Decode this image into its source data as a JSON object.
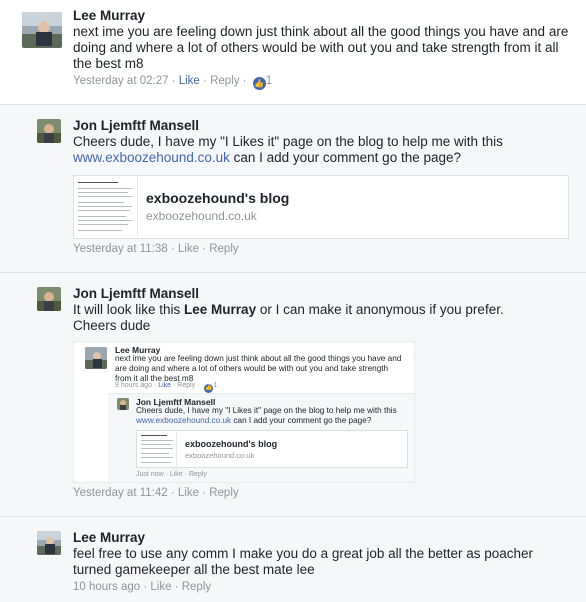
{
  "comments": [
    {
      "author": "Lee Murray",
      "text": "next ime you are feeling down just think about all the good things you have and are doing and where a lot of others would be with out you and take strength from it all the best m8",
      "time": "Yesterday at 02:27",
      "like_label": "Like",
      "reply_label": "Reply",
      "reaction_count": "1",
      "avatar_icon": "profile-photo-icon"
    },
    {
      "author": "Jon Ljemftf Mansell",
      "text_before_link": "Cheers dude, I have my \"I Likes it\" page on the blog to help me with this",
      "link": "www.exboozehound.co.uk",
      "text_after_link": " can I add your comment go the page?",
      "card_title": "exboozehound's blog",
      "card_domain": "exboozehound.co.uk",
      "time": "Yesterday at 11:38",
      "like_label": "Like",
      "reply_label": "Reply",
      "avatar_icon": "profile-photo-icon"
    },
    {
      "author": "Jon Ljemftf Mansell",
      "text_before_mention": "It will look like this ",
      "mention": "Lee Murray",
      "text_after_mention": " or I can make it anonymous if you prefer.",
      "text_line2": "Cheers dude",
      "time": "Yesterday at 11:42",
      "like_label": "Like",
      "reply_label": "Reply",
      "avatar_icon": "profile-photo-icon"
    },
    {
      "author": "Lee Murray",
      "text": "feel free to use any comm I make you do a great job all the better as poacher turned gamekeeper all the best mate lee",
      "time": "10 hours ago",
      "like_label": "Like",
      "reply_label": "Reply",
      "avatar_icon": "profile-photo-icon"
    }
  ],
  "embedded_screenshot": {
    "c1_author": "Lee Murray",
    "c1_text": "next ime you are feeling down just think about all the good things you have and are doing and where a lot of others would be with out you and take strength from it all the best m8",
    "c1_time": "9 hours ago",
    "c1_like": "Like",
    "c1_reply": "Reply",
    "c1_count": "1",
    "c2_author": "Jon Ljemftf Mansell",
    "c2_text_before_link": "Cheers dude, I have my \"I Likes it\" page on the blog to help me with this",
    "c2_link": "www.exboozehound.co.uk",
    "c2_text_after_link": " can I add your comment go the page?",
    "c2_card_title": "exboozehound's blog",
    "c2_card_domain": "exboozehound.co.uk",
    "c2_time": "Just now",
    "c2_like": "Like",
    "c2_reply": "Reply"
  },
  "colors": {
    "link": "#4267b2",
    "meta": "#90949c",
    "text": "#1d2129",
    "reply_bg": "#f6f7f9",
    "divider": "#dddfe2"
  }
}
